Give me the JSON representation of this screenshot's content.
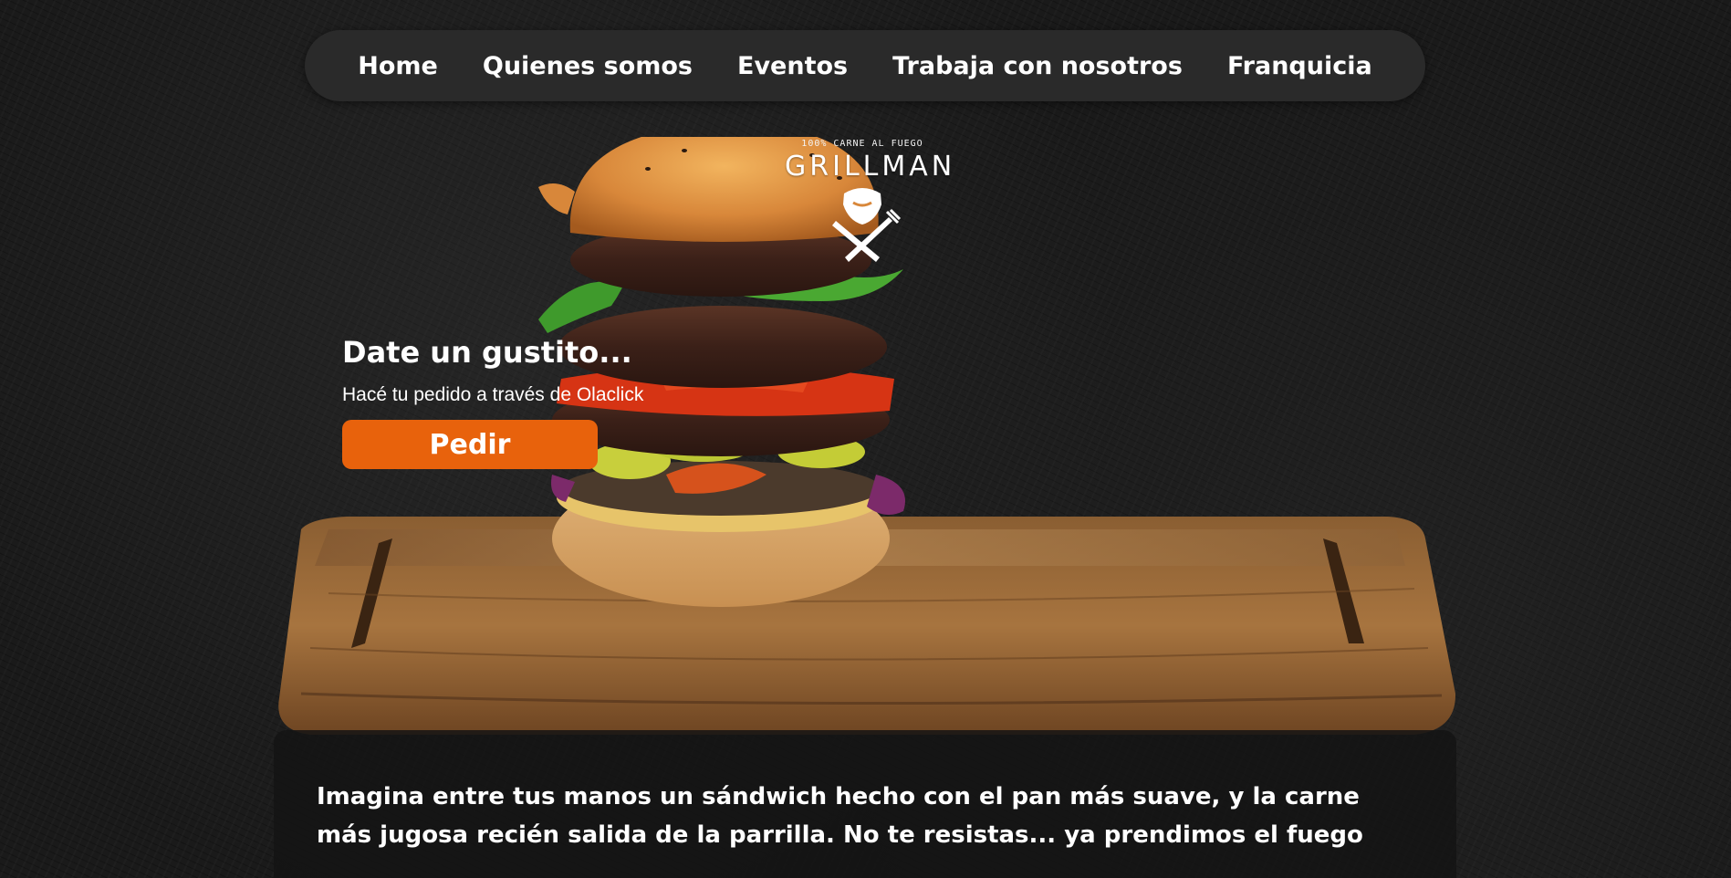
{
  "nav": {
    "items": [
      {
        "label": "Home"
      },
      {
        "label": "Quienes somos"
      },
      {
        "label": "Eventos"
      },
      {
        "label": "Trabaja con nosotros"
      },
      {
        "label": "Franquicia"
      }
    ]
  },
  "logo": {
    "tagline": "100% CARNE AL FUEGO",
    "name": "GRILLMAN"
  },
  "hero": {
    "heading": "Date un gustito...",
    "subheading": "Hacé tu pedido a través de Olaclick",
    "button_label": "Pedir"
  },
  "intro": {
    "text": "Imagina entre tus manos un sándwich hecho con el pan más suave, y la carne más jugosa recién salida de la parrilla. No te resistas... ya prendimos el fuego"
  },
  "colors": {
    "accent": "#e8620c",
    "background": "#1a1a1a",
    "nav_background": "#2a2a2a"
  }
}
